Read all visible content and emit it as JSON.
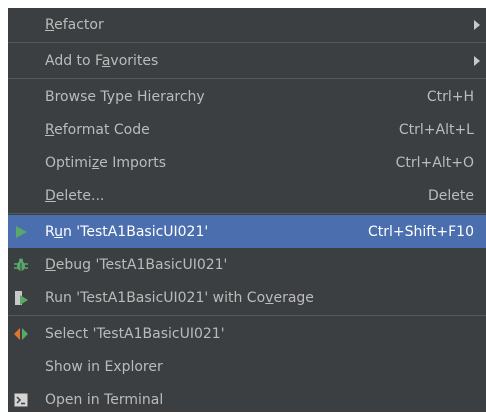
{
  "menu": {
    "items": [
      {
        "pre": "",
        "mn": "R",
        "post": "efactor",
        "submenu": true
      },
      {
        "pre": "Add to F",
        "mn": "a",
        "post": "vorites",
        "submenu": true
      },
      {
        "pre": "Browse Type Hierarchy",
        "mn": "",
        "post": "",
        "shortcut": "Ctrl+H"
      },
      {
        "pre": "",
        "mn": "R",
        "post": "eformat Code",
        "shortcut": "Ctrl+Alt+L"
      },
      {
        "pre": "Optimi",
        "mn": "z",
        "post": "e Imports",
        "shortcut": "Ctrl+Alt+O"
      },
      {
        "pre": "",
        "mn": "D",
        "post": "elete...",
        "shortcut": "Delete"
      },
      {
        "pre": "R",
        "mn": "u",
        "post": "n 'TestA1BasicUI021'",
        "shortcut": "Ctrl+Shift+F10",
        "icon": "run-icon",
        "selected": true
      },
      {
        "pre": "",
        "mn": "D",
        "post": "ebug 'TestA1BasicUI021'",
        "icon": "debug-icon"
      },
      {
        "pre": "Run 'TestA1BasicUI021' with Co",
        "mn": "v",
        "post": "erage",
        "icon": "coverage-icon"
      },
      {
        "pre": "Select 'TestA1BasicUI021'",
        "mn": "",
        "post": "",
        "icon": "select-target-icon"
      },
      {
        "pre": "Show in Explorer",
        "mn": "",
        "post": ""
      },
      {
        "pre": "Open in Terminal",
        "mn": "",
        "post": "",
        "icon": "terminal-icon"
      }
    ]
  },
  "colors": {
    "background": "#3c3f41",
    "selected": "#4b6eaf",
    "text": "#bbbbbb",
    "separator": "#555859",
    "run_green": "#59a869",
    "select_orange": "#e0752d"
  }
}
